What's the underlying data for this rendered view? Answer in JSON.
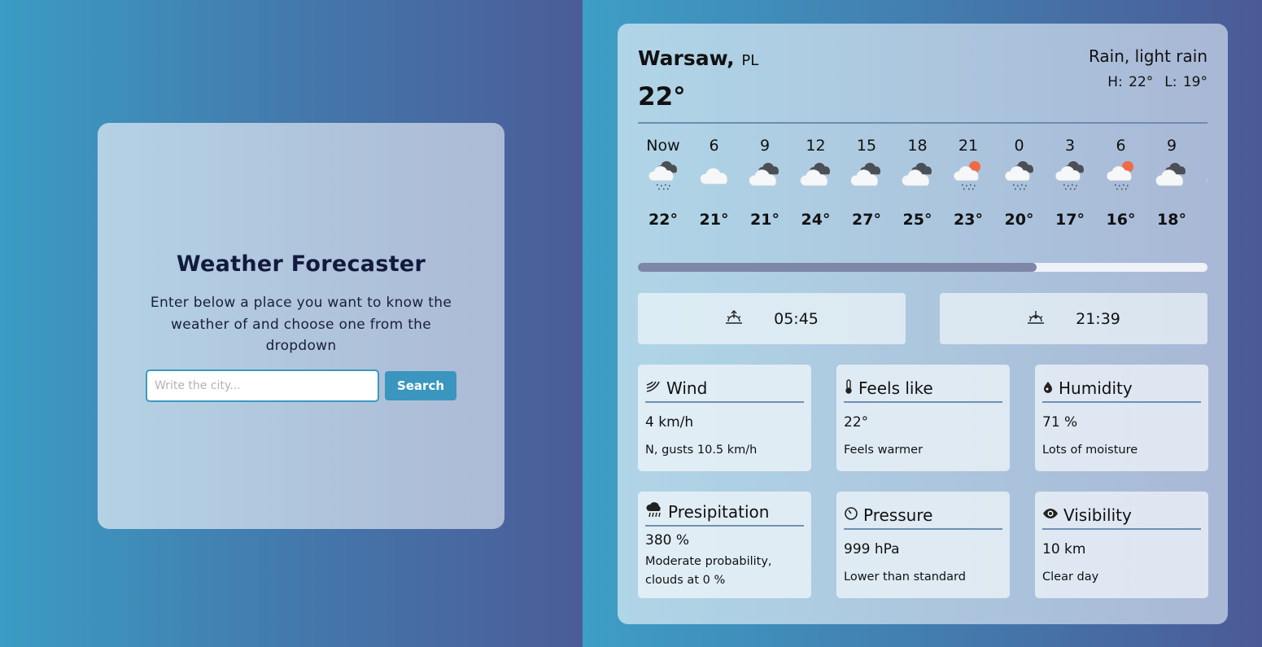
{
  "search": {
    "title": "Weather Forecaster",
    "description": "Enter below a place you want to know the weather of and choose one from the dropdown",
    "placeholder": "Write the city...",
    "button_label": "Search"
  },
  "current": {
    "city": "Warsaw,",
    "country": "PL",
    "temperature": "22°",
    "condition": "Rain, light rain",
    "high": "H: 22°",
    "low": "L: 19°"
  },
  "hourly": [
    {
      "label": "Now",
      "icon": "cloud-rain-icon",
      "temp": "22°"
    },
    {
      "label": "6",
      "icon": "cloud-icon",
      "temp": "21°"
    },
    {
      "label": "9",
      "icon": "cloud-dark-icon",
      "temp": "21°"
    },
    {
      "label": "12",
      "icon": "cloud-dark-icon",
      "temp": "24°"
    },
    {
      "label": "15",
      "icon": "cloud-dark-icon",
      "temp": "27°"
    },
    {
      "label": "18",
      "icon": "cloud-dark-icon",
      "temp": "25°"
    },
    {
      "label": "21",
      "icon": "cloud-sun-rain-icon",
      "temp": "23°"
    },
    {
      "label": "0",
      "icon": "cloud-rain-icon",
      "temp": "20°"
    },
    {
      "label": "3",
      "icon": "cloud-rain-icon",
      "temp": "17°"
    },
    {
      "label": "6",
      "icon": "cloud-sun-rain-icon",
      "temp": "16°"
    },
    {
      "label": "9",
      "icon": "cloud-dark-icon",
      "temp": "18°"
    }
  ],
  "hourly_scroll_fraction": 0.7,
  "sun": {
    "sunrise": "05:45",
    "sunset": "21:39"
  },
  "tiles": {
    "wind": {
      "title": "Wind",
      "value": "4 km/h",
      "desc": "N, gusts 10.5 km/h",
      "icon": "wind-icon"
    },
    "feels": {
      "title": "Feels like",
      "value": "22°",
      "desc": "Feels warmer",
      "icon": "thermometer-icon"
    },
    "humidity": {
      "title": "Humidity",
      "value": "71 %",
      "desc": "Lots of moisture",
      "icon": "droplet-icon"
    },
    "precip": {
      "title": "Presipitation",
      "value": "380 %",
      "desc": "Moderate probability, clouds at 0 %",
      "icon": "rain-cloud-icon"
    },
    "pressure": {
      "title": "Pressure",
      "value": "999 hPa",
      "desc": "Lower than standard",
      "icon": "gauge-icon"
    },
    "visibility": {
      "title": "Visibility",
      "value": "10 km",
      "desc": "Clear day",
      "icon": "eye-icon"
    }
  },
  "colors": {
    "accent": "#3a96bf",
    "title": "#121a3e",
    "divider": "#6c8db0",
    "scroll_thumb": "#7e87a8"
  }
}
